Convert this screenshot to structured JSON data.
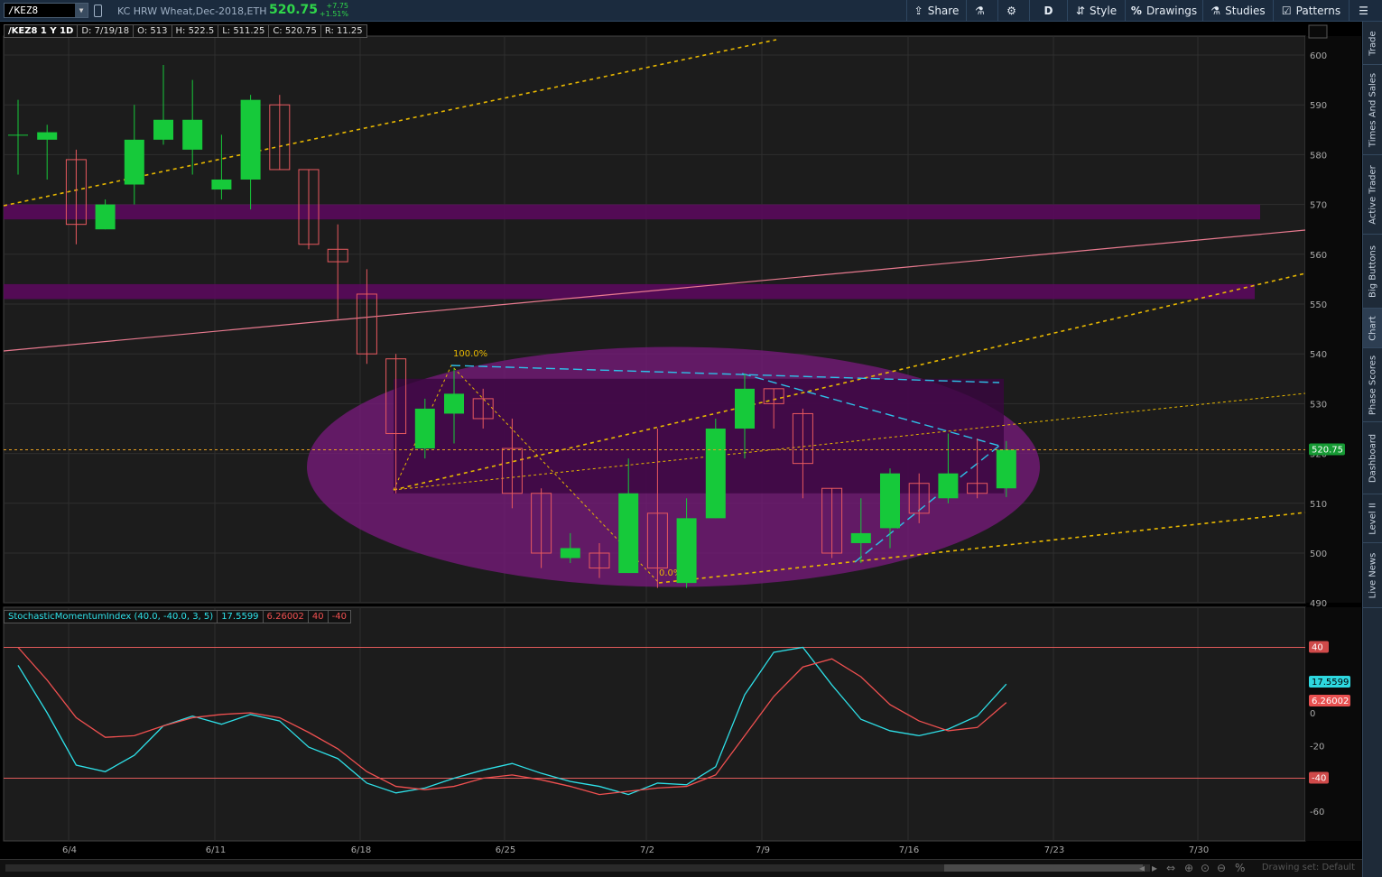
{
  "header": {
    "symbol": "/KEZ8",
    "description": "KC HRW Wheat,Dec-2018,ETH",
    "last": "520.75",
    "change": "+7.75",
    "change_pct": "+1.51%",
    "toolbar": {
      "share": "Share",
      "aggregation": "D",
      "style": "Style",
      "drawings": "Drawings",
      "studies": "Studies",
      "patterns": "Patterns"
    }
  },
  "info_bar": {
    "title": "/KEZ8 1 Y 1D",
    "date": "D: 7/19/18",
    "open": "O: 513",
    "high": "H: 522.5",
    "low": "L: 511.25",
    "close": "C: 520.75",
    "range": "R: 11.25"
  },
  "study_bar": {
    "name": "StochasticMomentumIndex (40.0, -40.0, 3, 5)",
    "v1": "17.5599",
    "v2": "6.26002",
    "v3": "40",
    "v4": "-40"
  },
  "sidebar": {
    "tabs": [
      "Trade",
      "Times And Sales",
      "Active Trader",
      "Big Buttons",
      "Chart",
      "Phase Scores",
      "Dashboard",
      "Level II",
      "Live News"
    ],
    "active": "Chart"
  },
  "bottom": {
    "drawing_set": "Drawing set: Default"
  },
  "colors": {
    "up": "#16c93a",
    "down": "#e8595f",
    "zone": "#5a0a5c",
    "ellipse": "#7a1a7e",
    "fib": "#e8b800",
    "trendline": "#2ec0e8",
    "pink_line": "#e87a8f",
    "smi_main": "#2ee0e8",
    "smi_signal": "#f05050"
  },
  "chart_data": [
    {
      "type": "candlestick",
      "title": "/KEZ8 1 Y 1D",
      "x_labels": [
        "6/4",
        "6/11",
        "6/18",
        "6/25",
        "7/2",
        "7/9",
        "7/16",
        "7/23",
        "7/30"
      ],
      "y_ticks": [
        490,
        500,
        510,
        520,
        530,
        540,
        550,
        560,
        570,
        580,
        590,
        600
      ],
      "ylim": [
        488,
        604
      ],
      "last_price_label": "520.75",
      "annotations": [
        "100.0%",
        "0.0%"
      ],
      "candles": [
        {
          "o": 584,
          "h": 591,
          "l": 576,
          "c": 584
        },
        {
          "o": 583,
          "h": 586,
          "l": 575,
          "c": 584.5
        },
        {
          "o": 579,
          "h": 581,
          "l": 562,
          "c": 566
        },
        {
          "o": 565,
          "h": 571,
          "l": 565,
          "c": 570
        },
        {
          "o": 574,
          "h": 590,
          "l": 570,
          "c": 583
        },
        {
          "o": 583,
          "h": 598,
          "l": 582,
          "c": 587
        },
        {
          "o": 581,
          "h": 595,
          "l": 576,
          "c": 587
        },
        {
          "o": 573,
          "h": 584,
          "l": 571,
          "c": 575
        },
        {
          "o": 575,
          "h": 592,
          "l": 569,
          "c": 591
        },
        {
          "o": 590,
          "h": 592,
          "l": 577,
          "c": 577
        },
        {
          "o": 577,
          "h": 577,
          "l": 561,
          "c": 562
        },
        {
          "o": 561,
          "h": 566,
          "l": 547,
          "c": 558.5
        },
        {
          "o": 552,
          "h": 557,
          "l": 538,
          "c": 540
        },
        {
          "o": 539,
          "h": 540,
          "l": 512,
          "c": 524
        },
        {
          "o": 521,
          "h": 531,
          "l": 519,
          "c": 529
        },
        {
          "o": 528,
          "h": 537,
          "l": 522,
          "c": 532
        },
        {
          "o": 531,
          "h": 533,
          "l": 525,
          "c": 527
        },
        {
          "o": 521,
          "h": 527,
          "l": 509,
          "c": 512
        },
        {
          "o": 512,
          "h": 513,
          "l": 497,
          "c": 500
        },
        {
          "o": 499,
          "h": 504,
          "l": 498,
          "c": 501
        },
        {
          "o": 500,
          "h": 502,
          "l": 495,
          "c": 497
        },
        {
          "o": 496,
          "h": 519,
          "l": 496,
          "c": 512
        },
        {
          "o": 508,
          "h": 525,
          "l": 493,
          "c": 497
        },
        {
          "o": 494,
          "h": 511,
          "l": 493,
          "c": 507
        },
        {
          "o": 507,
          "h": 527,
          "l": 507,
          "c": 525
        },
        {
          "o": 525,
          "h": 536,
          "l": 519,
          "c": 533
        },
        {
          "o": 533,
          "h": 533,
          "l": 525,
          "c": 530
        },
        {
          "o": 528,
          "h": 529,
          "l": 511,
          "c": 518
        },
        {
          "o": 513,
          "h": 513,
          "l": 499,
          "c": 500
        },
        {
          "o": 502,
          "h": 511,
          "l": 498,
          "c": 504
        },
        {
          "o": 505,
          "h": 517,
          "l": 501,
          "c": 516
        },
        {
          "o": 514,
          "h": 516,
          "l": 506,
          "c": 508
        },
        {
          "o": 511,
          "h": 524,
          "l": 510,
          "c": 516
        },
        {
          "o": 514,
          "h": 523,
          "l": 511,
          "c": 512
        },
        {
          "o": 513,
          "h": 522.5,
          "l": 511.25,
          "c": 520.75
        }
      ]
    },
    {
      "type": "line",
      "title": "StochasticMomentumIndex (40.0, -40.0, 3, 5)",
      "y_ticks": [
        -60,
        -20,
        0,
        40
      ],
      "ylim": [
        -70,
        52
      ],
      "levels": [
        40,
        -40
      ],
      "series": [
        {
          "name": "17.5599",
          "values": [
            29,
            0,
            -32,
            -36,
            -26,
            -8,
            -2,
            -7,
            -1,
            -5,
            -21,
            -28,
            -43,
            -49,
            -46,
            -40,
            -35,
            -31,
            -37,
            -42,
            -45,
            -50,
            -43,
            -44,
            -33,
            11,
            37,
            40,
            17,
            -4,
            -11,
            -14,
            -10,
            -2,
            17.56
          ]
        },
        {
          "name": "6.26002",
          "values": [
            40,
            20,
            -3,
            -15,
            -14,
            -8,
            -3,
            -1,
            0,
            -3,
            -12,
            -22,
            -36,
            -45,
            -47,
            -45,
            -40,
            -38,
            -41,
            -45,
            -50,
            -48,
            -46,
            -45,
            -38,
            -14,
            10,
            28,
            33,
            22,
            5,
            -5,
            -11,
            -9,
            6.26
          ]
        }
      ]
    }
  ]
}
